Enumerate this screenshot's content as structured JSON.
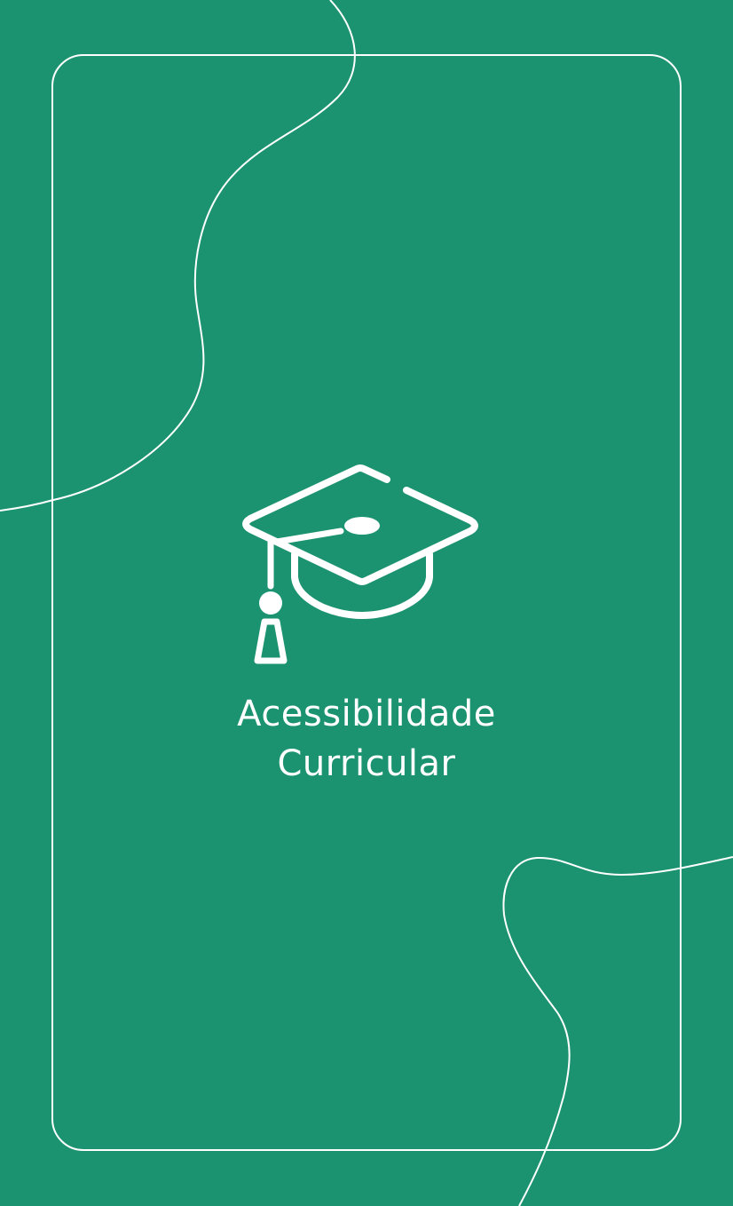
{
  "card": {
    "title_line1": "Acessibilidade",
    "title_line2": "Curricular",
    "icon": "graduation-cap-icon",
    "background_color": "#1c9370",
    "line_color": "#ffffff"
  }
}
